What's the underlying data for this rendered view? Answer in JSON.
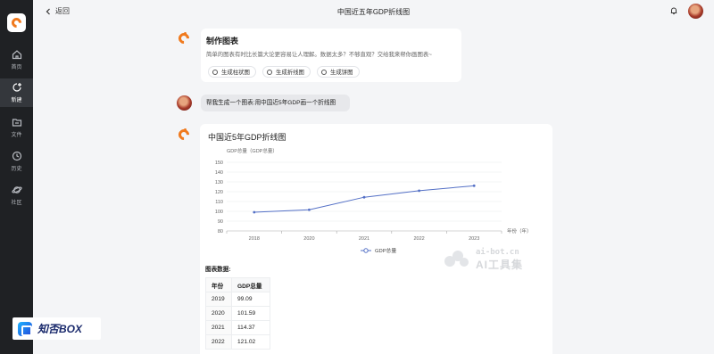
{
  "sidebar": {
    "items": [
      {
        "label": "首页",
        "icon": "home-icon"
      },
      {
        "label": "新建",
        "icon": "new-chat-icon",
        "active": true
      },
      {
        "label": "文件",
        "icon": "folder-icon"
      },
      {
        "label": "历史",
        "icon": "clock-icon"
      },
      {
        "label": "社区",
        "icon": "planet-icon"
      }
    ]
  },
  "header": {
    "back_label": "返回",
    "title": "中国近五年GDP折线图"
  },
  "welcome": {
    "title": "制作图表",
    "description": "简单的图表有时比长篇大论更容易让人理解。数据太多？不够直观？交给我来帮你画图表~",
    "chips": [
      "生成柱状图",
      "生成折线图",
      "生成饼图"
    ]
  },
  "user_message": "帮我生成一个图表:用中国近5年GDP画一个折线图",
  "chart_card": {
    "title": "中国近5年GDP折线图",
    "data_title": "图表数据:",
    "table": {
      "headers": [
        "年份",
        "GDP总量"
      ],
      "rows": [
        [
          "2019",
          "99.09"
        ],
        [
          "2020",
          "101.59"
        ],
        [
          "2021",
          "114.37"
        ],
        [
          "2022",
          "121.02"
        ]
      ]
    }
  },
  "chart_data": {
    "type": "line",
    "ylabel": "GDP总量（GDP总量）",
    "xlabel": "年份（年）",
    "categories": [
      "2018",
      "2020",
      "2021",
      "2022",
      "2023"
    ],
    "series": [
      {
        "name": "GDP总量",
        "values": [
          99.09,
          101.59,
          114.37,
          121.02,
          126.06
        ]
      }
    ],
    "ylim": [
      80,
      150
    ],
    "yticks": [
      80,
      90,
      100,
      110,
      120,
      130,
      140,
      150
    ],
    "grid": true,
    "legend": "bottom",
    "color": "#5470c6"
  },
  "watermark": {
    "line1": "ai-bot.cn",
    "line2": "AI工具集"
  },
  "brand": {
    "text": "知否BOX"
  }
}
